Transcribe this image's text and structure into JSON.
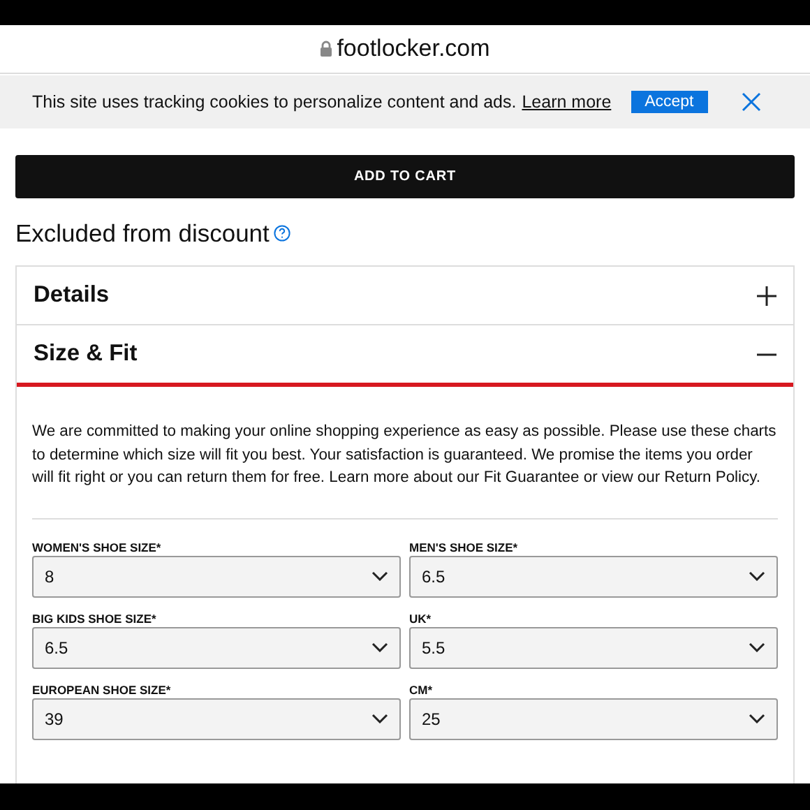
{
  "address_bar": {
    "url": "footlocker.com"
  },
  "cookie_banner": {
    "message": "This site uses tracking cookies to personalize content and ads.",
    "link": "Learn more",
    "accept": "Accept"
  },
  "add_to_cart": "ADD TO CART",
  "discount_note": "Excluded from discount",
  "sections": [
    {
      "title": "Details",
      "expanded": false
    },
    {
      "title": "Size & Fit",
      "expanded": true
    }
  ],
  "size_fit": {
    "intro": "We are committed to making your online shopping experience as easy as possible. Please use these charts to determine which size will fit you best. Your satisfaction is guaranteed. We promise the items you order will fit right or you can return them for free. Learn more about our Fit Guarantee or view our Return Policy.",
    "selects": [
      {
        "label": "WOMEN'S SHOE SIZE*",
        "value": "8"
      },
      {
        "label": "MEN'S SHOE SIZE*",
        "value": "6.5"
      },
      {
        "label": "BIG KIDS SHOE SIZE*",
        "value": "6.5"
      },
      {
        "label": "UK*",
        "value": "5.5"
      },
      {
        "label": "EUROPEAN SHOE SIZE*",
        "value": "39"
      },
      {
        "label": "CM*",
        "value": "25"
      }
    ]
  }
}
